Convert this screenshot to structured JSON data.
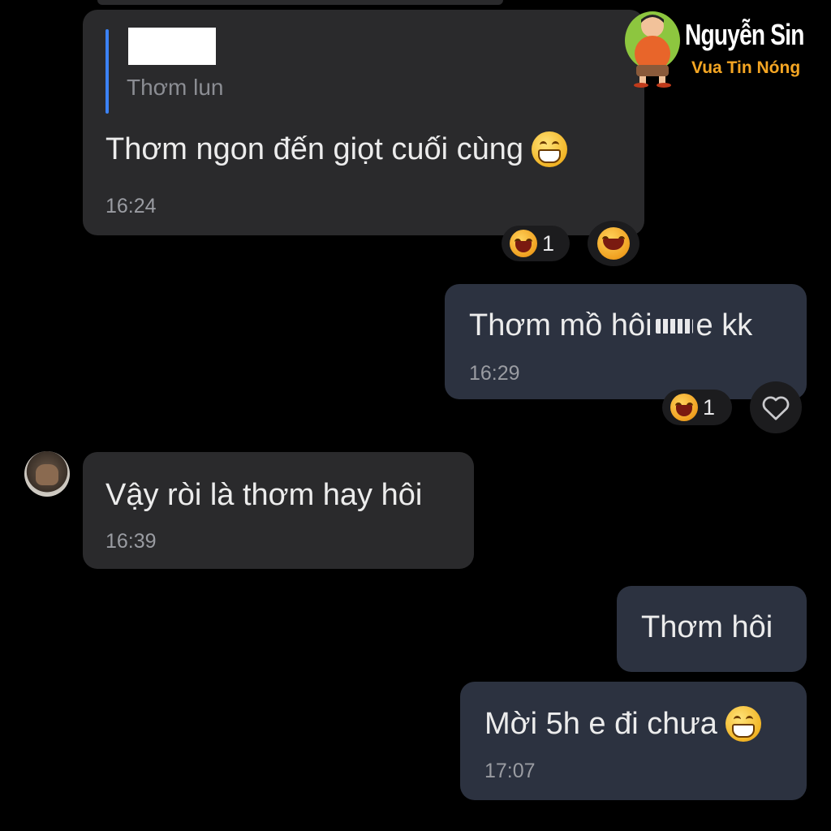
{
  "messages": [
    {
      "id": "m1",
      "direction": "incoming",
      "quote": {
        "author_redacted": true,
        "text": "Thơm lun"
      },
      "text": "Thơm ngon đến giọt cuối cùng",
      "emoji": "grinning-face",
      "time": "16:24",
      "reactions": [
        {
          "emoji": "laughing-face",
          "count": "1"
        }
      ],
      "my_reaction": "laughing-face"
    },
    {
      "id": "m2",
      "direction": "outgoing",
      "text_before": "Thơm mồ hôi",
      "text_after": "e kk",
      "redacted": true,
      "time": "16:29",
      "reactions": [
        {
          "emoji": "laughing-face",
          "count": "1"
        }
      ],
      "react_button": "heart-outline"
    },
    {
      "id": "m3",
      "direction": "incoming",
      "avatar": true,
      "text": "Vậy ròi là thơm hay hôi",
      "time": "16:39"
    },
    {
      "id": "m4",
      "direction": "outgoing",
      "text": "Thơm hôi"
    },
    {
      "id": "m5",
      "direction": "outgoing",
      "text": "Mời 5h e đi chưa",
      "emoji": "grinning-face",
      "time": "17:07"
    }
  ],
  "watermark": {
    "name": "Nguyễn Sin",
    "tagline": "Vua Tin Nóng",
    "colors": {
      "name": "#ffffff",
      "tagline": "#f5a623"
    }
  },
  "colors": {
    "background": "#000000",
    "incoming_bubble": "#2a2a2c",
    "outgoing_bubble": "#2c3240",
    "quote_bar": "#3b82f6",
    "timestamp": "#9a9ca2"
  }
}
